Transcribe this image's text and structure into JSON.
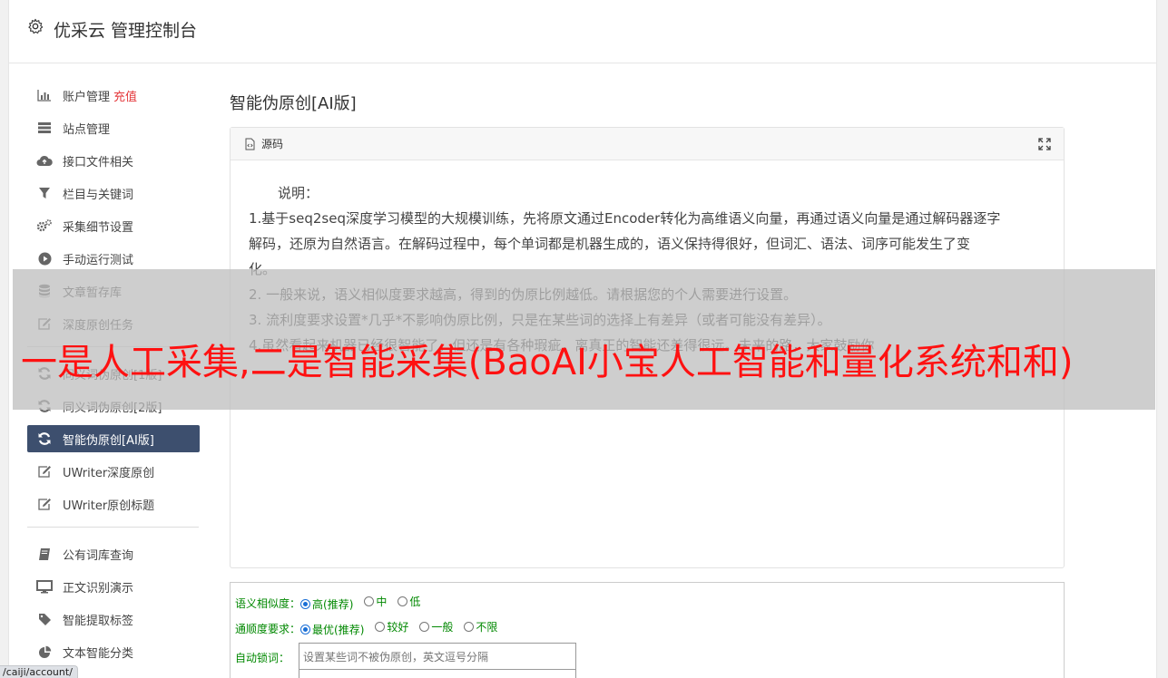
{
  "header": {
    "icon": "gear-icon",
    "title": "优采云 管理控制台"
  },
  "sidebar": {
    "groups": [
      [
        {
          "label": "账户管理",
          "tag": "充值",
          "icon": "bar-chart-icon"
        },
        {
          "label": "站点管理",
          "icon": "server-list-icon"
        },
        {
          "label": "接口文件相关",
          "icon": "cloud-upload-icon"
        },
        {
          "label": "栏目与关键词",
          "icon": "filter-icon"
        },
        {
          "label": "采集细节设置",
          "icon": "cogs-icon"
        },
        {
          "label": "手动运行测试",
          "icon": "play-circle-icon"
        },
        {
          "label": "文章暂存库",
          "icon": "database-icon"
        },
        {
          "label": "深度原创任务",
          "icon": "edit-icon"
        }
      ],
      [
        {
          "label": "同义词伪原创[1版]",
          "icon": "refresh-icon"
        },
        {
          "label": "同义词伪原创[2版]",
          "icon": "refresh-icon"
        },
        {
          "label": "智能伪原创[AI版]",
          "icon": "refresh-icon",
          "active": true
        },
        {
          "label": "UWriter深度原创",
          "icon": "edit-icon"
        },
        {
          "label": "UWriter原创标题",
          "icon": "edit-icon"
        }
      ],
      [
        {
          "label": "公有词库查询",
          "icon": "book-icon"
        },
        {
          "label": "正文识别演示",
          "icon": "monitor-icon"
        },
        {
          "label": "智能提取标签",
          "icon": "tag-icon"
        },
        {
          "label": "文本智能分类",
          "icon": "pie-chart-icon"
        }
      ]
    ]
  },
  "main": {
    "title": "智能伪原创[AI版]",
    "panel": {
      "head_label": "源码",
      "note_title": "说明：",
      "lines": [
        "1.基于seq2seq深度学习模型的大规模训练，先将原文通过Encoder转化为高维语义向量，再通过语义向量是通过解码器逐字",
        "解码，还原为自然语言。在解码过程中，每个单词都是机器生成的，语义保持得很好，但词汇、语法、词序可能发生了变",
        "化。",
        "2. 一般来说，语义相似度要求越高，得到的伪原比例越低。请根据您的个人需要进行设置。",
        "3. 流利度要求设置*几乎*不影响伪原比例，只是在某些词的选择上有差异（或者可能没有差异）。",
        "4.虽然看起来机器已经很智能了，但还是有各种瑕疵，离真正的智能还差得很远。未来的路，大家鼓励你"
      ]
    },
    "form": {
      "similarity_label": "语义相似度：",
      "similarity_options": [
        {
          "label": "高(推荐)",
          "checked": true
        },
        {
          "label": "中",
          "checked": false
        },
        {
          "label": "低",
          "checked": false
        }
      ],
      "fluency_label": "通顺度要求：",
      "fluency_options": [
        {
          "label": "最优(推荐)",
          "checked": true
        },
        {
          "label": "较好",
          "checked": false
        },
        {
          "label": "一般",
          "checked": false
        },
        {
          "label": "不限",
          "checked": false
        }
      ],
      "lock_label": "自动锁词：",
      "lock_placeholder": "设置某些词不被伪原创，英文逗号分隔"
    }
  },
  "overlay": {
    "text": "一是人工采集,二是智能采集(BaoAI小宝人工智能和量化系统和和)"
  },
  "status_url": "/caiji/account/"
}
